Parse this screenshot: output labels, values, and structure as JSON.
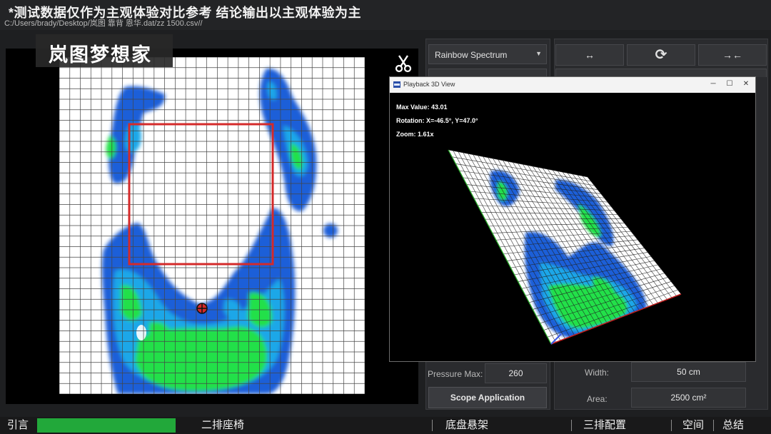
{
  "banner": {
    "disclaimer": "*测试数据仅作为主观体验对比参考 结论输出以主观体验为主",
    "file_path": "C:/Users/brady/Desktop/岚图 靠背 恩华.dat/zz 1500.csv//"
  },
  "watermark": {
    "text": "岚图梦想家"
  },
  "toolbar": {
    "colormap_selected": "Rainbow Spectrum",
    "buttons": [
      {
        "name": "expand-horizontal-button",
        "label": "↔"
      },
      {
        "name": "refresh-button",
        "label": "⟳"
      },
      {
        "name": "collapse-horizontal-button",
        "label": "→←"
      }
    ]
  },
  "fields": {
    "pressure_max_label": "Pressure Max:",
    "pressure_max_value": "260",
    "width_label": "Width:",
    "width_value": "50 cm",
    "area_label": "Area:",
    "area_value": "2500 cm²",
    "scope_button": "Scope Application"
  },
  "window3d": {
    "title": "Playback 3D View",
    "max_value": "Max Value: 43.01",
    "rotation": "Rotation: X=-46.5°, Y=47.0°",
    "zoom": "Zoom: 1.61x"
  },
  "footer": {
    "sections": [
      "引言",
      "二排座椅",
      "底盘悬架",
      "三排配置",
      "空间",
      "总结"
    ],
    "progress_fraction": 0.18
  },
  "colors": {
    "accent_red": "#d42a2a",
    "pressure_blue": "#1f5fd8",
    "pressure_cyan": "#1ea7e8",
    "pressure_green": "#22e04a",
    "footer_green": "#22a83a"
  }
}
